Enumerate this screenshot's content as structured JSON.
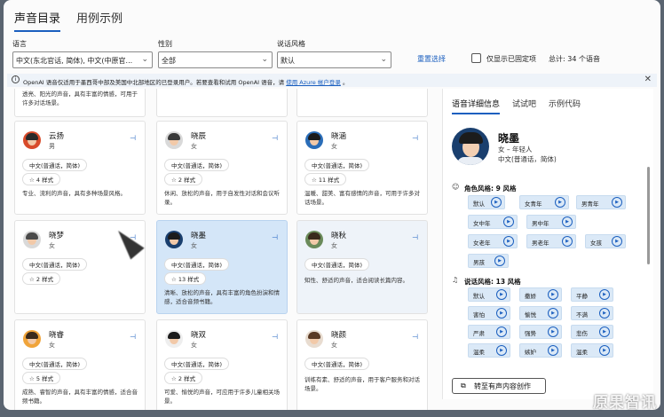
{
  "tabs": [
    "声音目录",
    "用例示例"
  ],
  "filters": {
    "language_label": "语言",
    "language_value": "中文(东北官话, 简体), 中文(中原官...",
    "gender_label": "性别",
    "gender_value": "全部",
    "style_label": "说话风格",
    "style_value": "默认",
    "reset_label": "重置选择",
    "pinned_only_label": "仅显示已固定项",
    "total_label": "总计: 34 个语音"
  },
  "notice": {
    "text": "OpenAI 语音仅适用于墨西哥中部及美国中北部地区的已登录用户。若要查看和试用 OpenAI 语音，请",
    "link": "使用 Azure 帐户登录",
    "suffix": "。"
  },
  "top_descs": [
    "透亮、阳光的声音，具有丰富的情感，可用于许多对话场景。"
  ],
  "cards": [
    {
      "name": "云扬",
      "gender": "男",
      "lang": "中文(普通话，简体)",
      "styles": "4 样式",
      "desc": "专业、流利的声音，具有多种场景风格。"
    },
    {
      "name": "晓辰",
      "gender": "女",
      "lang": "中文(普通话，简体)",
      "styles": "2 样式",
      "desc": "休闲、放松的声音，用于自发性对话和会议听录。"
    },
    {
      "name": "晓涵",
      "gender": "女",
      "lang": "中文(普通话，简体)",
      "styles": "11 样式",
      "desc": "温暖、甜美、富有感情的声音，可用于许多对话场景。"
    },
    {
      "name": "晓梦",
      "gender": "女",
      "lang": "中文(普通话，简体)",
      "styles": "2 样式",
      "desc": ""
    },
    {
      "name": "晓墨",
      "gender": "女",
      "lang": "中文(普通话，简体)",
      "styles": "13 样式",
      "desc": "清晰、放松的声音，具有丰富的角色扮演和情感，适合音频书籍。"
    },
    {
      "name": "晓秋",
      "gender": "女",
      "lang": "中文(普通话，简体)",
      "styles": "",
      "desc": "知性、舒适的声音，适合阅读长篇内容。"
    },
    {
      "name": "晓睿",
      "gender": "女",
      "lang": "中文(普通话，简体)",
      "styles": "5 样式",
      "desc": "成熟、睿智的声音，具有丰富的情感，适合音频书籍。"
    },
    {
      "name": "晓双",
      "gender": "女",
      "lang": "中文(普通话，简体)",
      "styles": "2 样式",
      "desc": "可爱、愉悦的声音，可应用于许多儿童相关场景。"
    },
    {
      "name": "晓颜",
      "gender": "女",
      "lang": "中文(普通话，简体)",
      "styles": "",
      "desc": "训练有素、舒适的声音，用于客户服务和对话场景。"
    }
  ],
  "panel": {
    "tabs": [
      "语音详细信息",
      "试试吧",
      "示例代码"
    ],
    "name": "晓墨",
    "meta1": "女 – 年轻人",
    "meta2": "中文(普通话，简体)",
    "role_title": "角色风格: 9 风格",
    "roles": [
      "默认",
      "女青年",
      "男青年",
      "女中年",
      "男中年",
      "女老年",
      "男老年",
      "女孩",
      "男孩"
    ],
    "speak_title": "说话风格: 13 风格",
    "speaks": [
      "默认",
      "撒娇",
      "平静",
      "害怕",
      "愉悦",
      "不满",
      "严肃",
      "强势",
      "悲伤",
      "温柔",
      "嫉妒",
      "温柔"
    ],
    "cta": "转至有声内容创作"
  },
  "watermark": "原果智讯",
  "colors": {
    "accent": "#1b5fbf",
    "selected_card": "#d4e6f8"
  }
}
